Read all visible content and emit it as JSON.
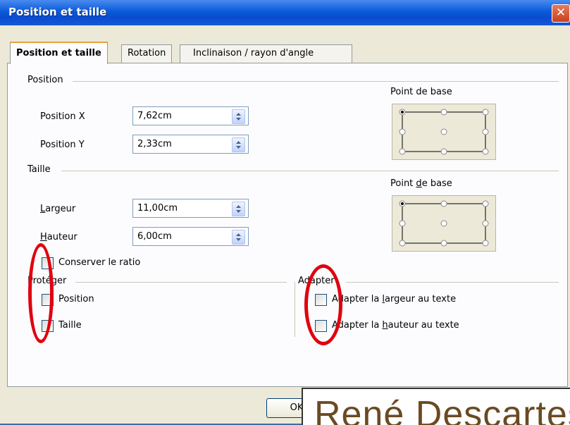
{
  "window": {
    "title": "Position et taille",
    "close_glyph": "✕"
  },
  "tabs": [
    {
      "label": "Position et taille",
      "active": true
    },
    {
      "label": "Rotation",
      "active": false
    },
    {
      "label": "Inclinaison / rayon d'angle",
      "active": false
    }
  ],
  "position": {
    "section_label": "Position",
    "x_label": "Position X",
    "x_value": "7,62cm",
    "y_label": "Position Y",
    "y_value": "2,33cm",
    "base_point_label": "Point de base"
  },
  "size": {
    "section_label": "Taille",
    "width_label": "Largeur",
    "width_value": "11,00cm",
    "height_label": "Hauteur",
    "height_value": "6,00cm",
    "base_point_label": "Point de base",
    "keep_ratio_label": "Conserver le ratio"
  },
  "protect": {
    "section_label": "Protéger",
    "position_label": "Position",
    "size_label": "Taille"
  },
  "adapt": {
    "section_label": "Adapter",
    "fit_width_label": "Adapter la largeur au texte",
    "fit_height_label": "Adapter la hauteur au texte"
  },
  "buttons": {
    "ok_label": "OK"
  },
  "overlay": {
    "text": "René Descartes"
  },
  "colors": {
    "titlebar": "#0a4ccd",
    "annotation": "#e0000f",
    "tab_highlight": "#e8a33b"
  }
}
